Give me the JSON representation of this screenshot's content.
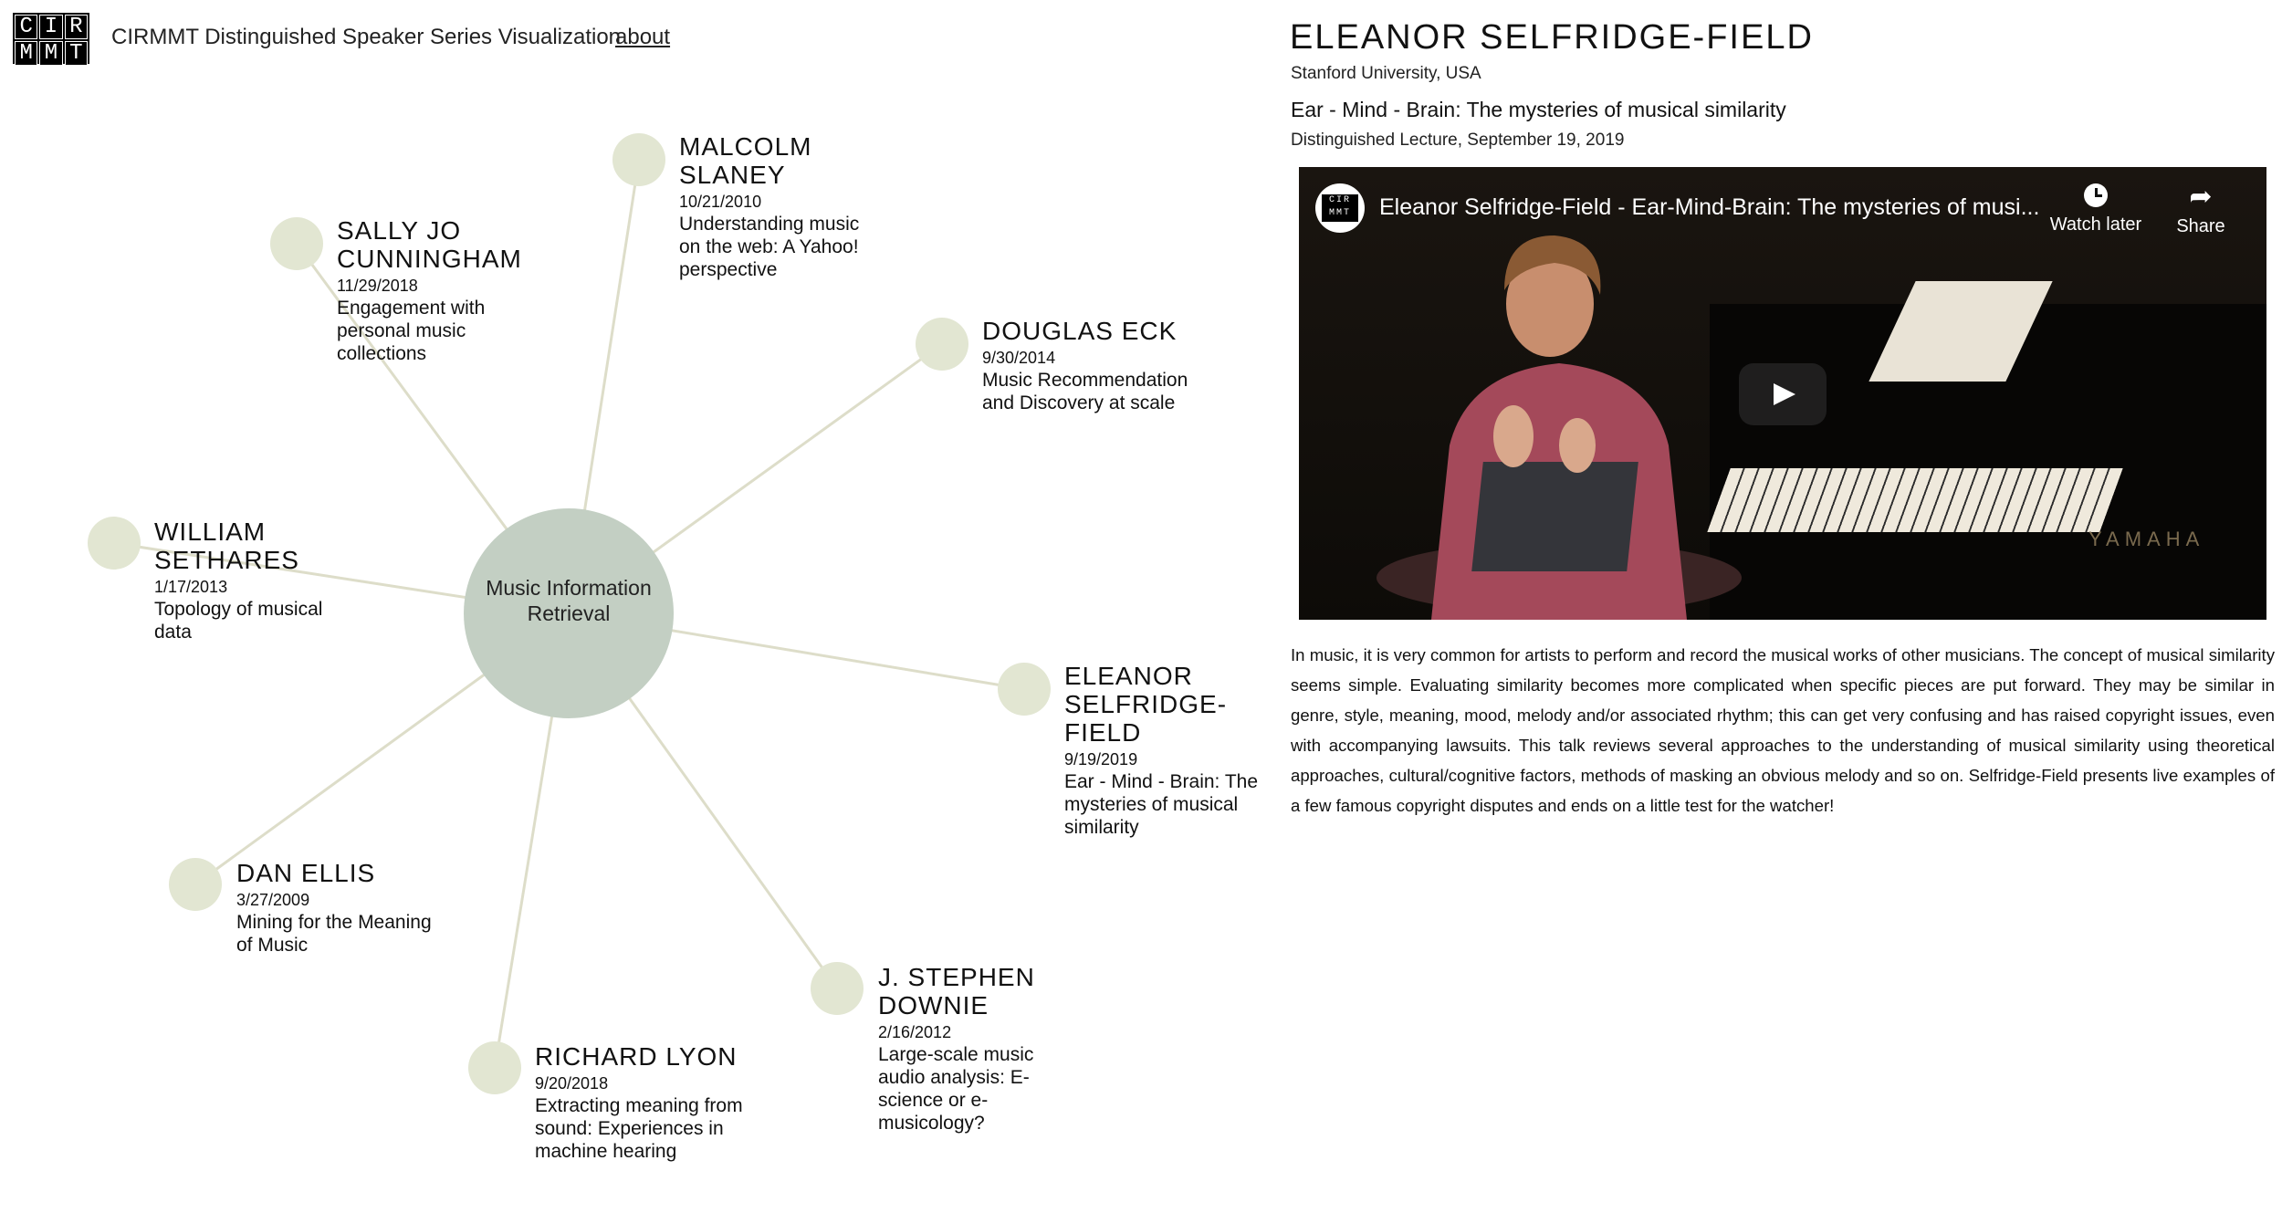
{
  "header": {
    "logo_letters": [
      "C",
      "I",
      "R",
      "M",
      "M",
      "T"
    ],
    "site_title": "CIRMMT Distinguished Speaker Series Visualization",
    "about_label": "about"
  },
  "graph": {
    "hub_label": "Music Information Retrieval",
    "colors": {
      "edge": "#ddddc9",
      "speaker_dot": "#e2e6d2",
      "hub": "#c3cfc3"
    },
    "speakers": [
      {
        "name": "MALCOLM SLANEY",
        "date": "10/21/2010",
        "talk": "Understanding music on the web: A Yahoo! perspective"
      },
      {
        "name": "SALLY JO CUNNINGHAM",
        "date": "11/29/2018",
        "talk": "Engagement with personal music collections"
      },
      {
        "name": "DOUGLAS ECK",
        "date": "9/30/2014",
        "talk": "Music Recommendation and Discovery at scale"
      },
      {
        "name": "WILLIAM SETHARES",
        "date": "1/17/2013",
        "talk": "Topology of musical data"
      },
      {
        "name": "ELEANOR SELFRIDGE-FIELD",
        "date": "9/19/2019",
        "talk": "Ear - Mind - Brain: The mysteries of musical similarity"
      },
      {
        "name": "DAN ELLIS",
        "date": "3/27/2009",
        "talk": "Mining for the Meaning of Music"
      },
      {
        "name": "J. STEPHEN DOWNIE",
        "date": "2/16/2012",
        "talk": "Large-scale music audio analysis: E-science or e-musicology?"
      },
      {
        "name": "RICHARD LYON",
        "date": "9/20/2018",
        "talk": "Extracting meaning from sound: Experiences in machine hearing"
      }
    ]
  },
  "detail": {
    "name": "ELEANOR SELFRIDGE-FIELD",
    "affiliation": "Stanford University, USA",
    "talk_title": "Ear - Mind - Brain: The mysteries of musical similarity",
    "event": "Distinguished Lecture, September 19, 2019",
    "video": {
      "title": "Eleanor Selfridge-Field - Ear-Mind-Brain: The mysteries of musi...",
      "watch_later_label": "Watch later",
      "share_label": "Share",
      "channel_logo": "CIR MMT",
      "brand_text": "YAMAHA"
    },
    "description": "In music, it is very common for artists to perform and record the musical works of other musicians. The concept of musical similarity seems simple. Evaluating similarity becomes more complicated when specific pieces are put forward. They may be similar in genre, style, meaning, mood, melody and/or associated rhythm; this can get very confusing and has raised copyright issues, even with accompanying lawsuits. This talk reviews several approaches to the understanding of musical similarity using theoretical approaches, cultural/cognitive factors, methods of masking an obvious melody and so on. Selfridge-Field presents live examples of a few famous copyright disputes and ends on a little test for the watcher!"
  }
}
